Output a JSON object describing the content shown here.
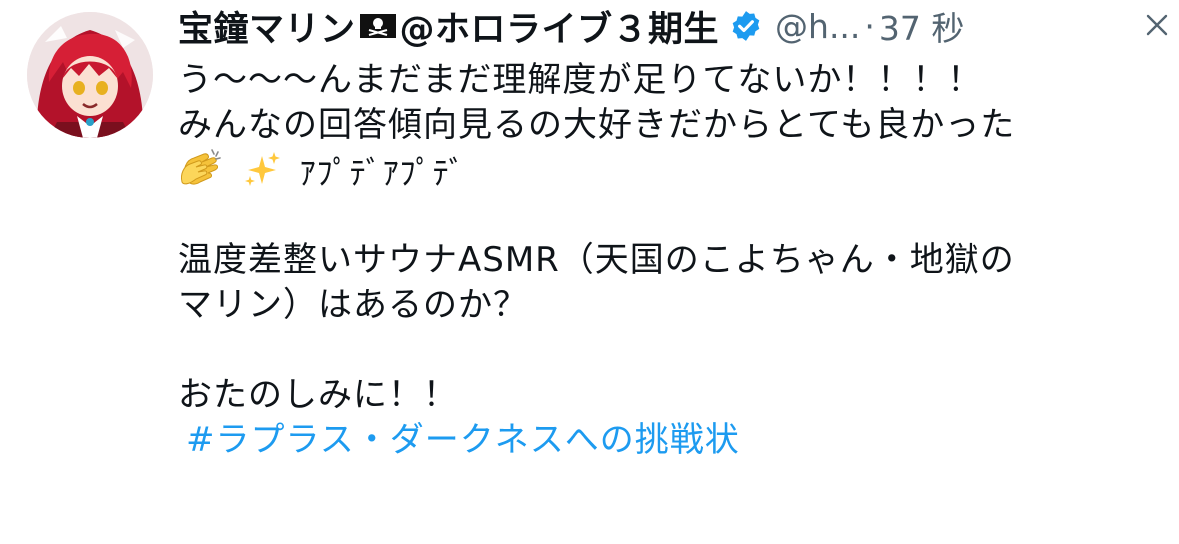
{
  "author": {
    "display_name": "宝鐘マリン",
    "display_name_suffix": "@ホロライブ３期生",
    "handle": "@h...",
    "separator": "·",
    "timestamp": "37 秒",
    "flag_icon": "pirate-flag-icon",
    "verified_icon": "verified-badge-icon",
    "verified_color": "#1d9bf0"
  },
  "tweet": {
    "line_1": "う〜〜〜んまだまだ理解度が足りてないか！！！！",
    "line_2": "みんなの回答傾向見るの大好きだからとても良かった",
    "line_3_text": "ｱﾌﾟﾃﾞｱﾌﾟﾃﾞ",
    "line_3_emojis": [
      "clapping-hands-icon",
      "sparkles-icon"
    ],
    "line_5": "温度差整いサウナASMR（天国のこよちゃん・地獄の",
    "line_6": "マリン）はあるのか？",
    "line_8": "おたのしみに！！",
    "hashtag": "#ラプラス・ダークネスへの挑戦状",
    "hashtag_color": "#1d9bf0"
  },
  "menu": {
    "more_icon": "more-options-icon"
  }
}
